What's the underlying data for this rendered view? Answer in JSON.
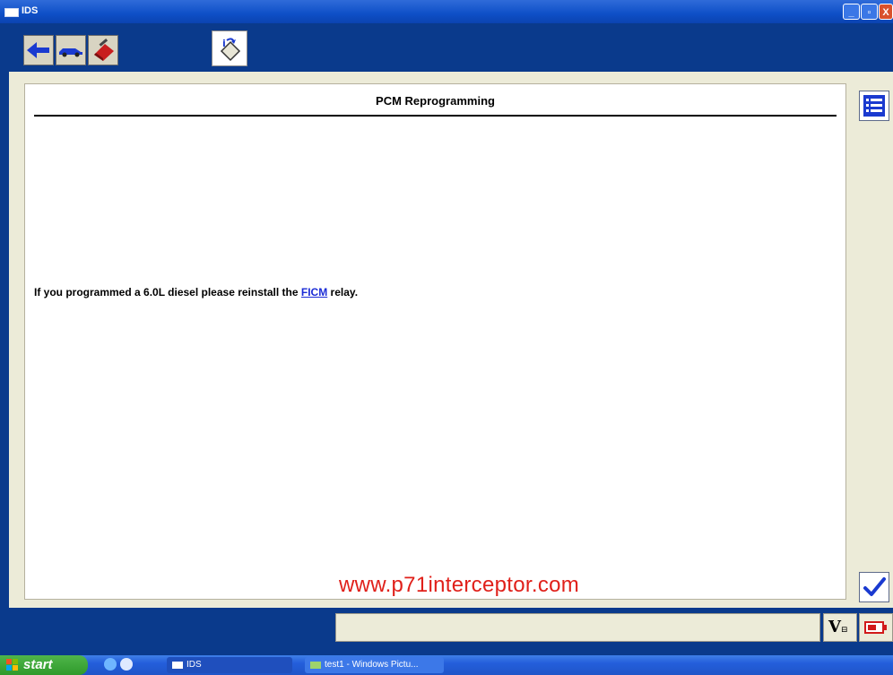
{
  "window": {
    "title": "IDS",
    "controls": {
      "minimize": "_",
      "maximize": "▫",
      "close": "X"
    }
  },
  "toolbar": {
    "buttons": [
      {
        "name": "back-arrow-icon"
      },
      {
        "name": "vehicle-icon"
      },
      {
        "name": "toolbox-icon"
      }
    ],
    "active_tab_icon": "info-flag-icon"
  },
  "page": {
    "title": "PCM Reprogramming",
    "message_before": "If you programmed a 6.0L diesel please reinstall the ",
    "message_link": "FICM",
    "message_after": " relay.",
    "watermark": "www.p71interceptor.com"
  },
  "status": {
    "field_text": "",
    "vbat_label": "V",
    "vbat_sub": "⊟"
  },
  "taskbar": {
    "start_label": "start",
    "tasks": [
      {
        "label": "IDS"
      },
      {
        "label": "test1 - Windows Pictu..."
      }
    ]
  },
  "colors": {
    "accent_blue": "#0a3a8c",
    "panel_beige": "#ecebd8",
    "link_blue": "#1a2bd6",
    "watermark_red": "#e0201a"
  }
}
